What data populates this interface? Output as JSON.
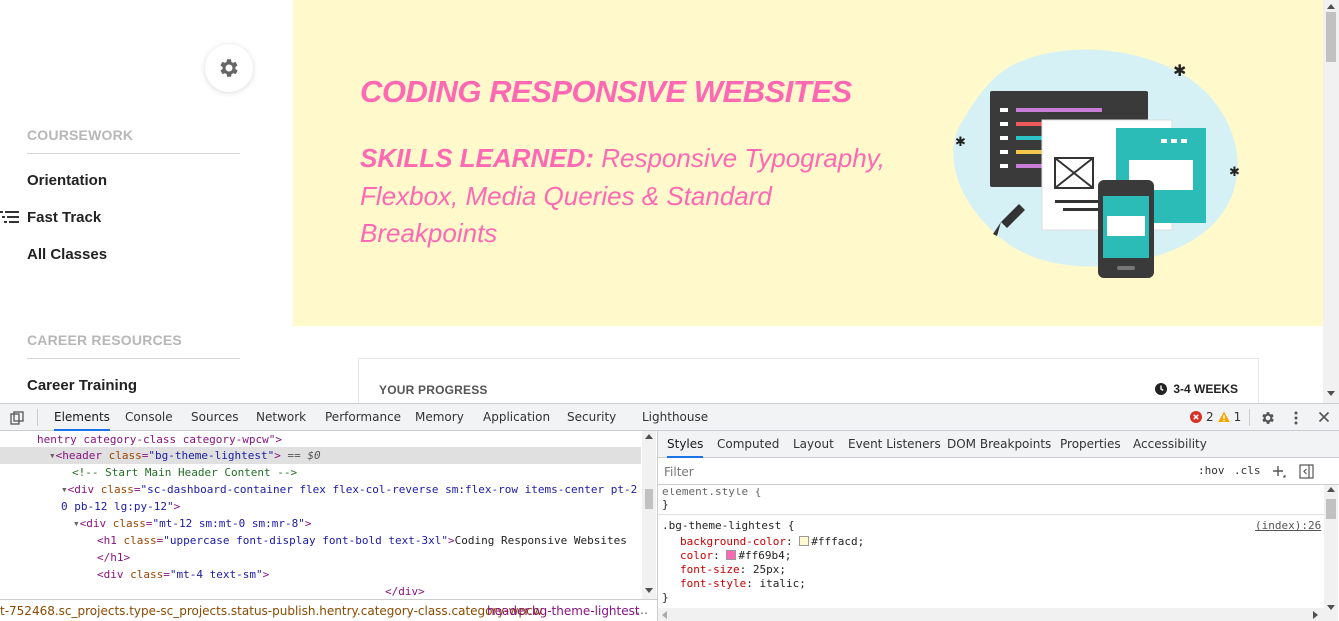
{
  "sidebar": {
    "coursework_title": "COURSEWORK",
    "coursework_items": [
      "Orientation",
      "Fast Track",
      "All Classes"
    ],
    "career_title": "CAREER RESOURCES",
    "career_items": [
      "Career Training"
    ]
  },
  "hero": {
    "title": "CODING RESPONSIVE WEBSITES",
    "skills_label": "SKILLS LEARNED:",
    "skills_text": " Responsive Typography, Flexbox, Media Queries & Standard Breakpoints",
    "background": "#fff9cc",
    "accent": "#ff69b4"
  },
  "progress": {
    "label": "YOUR PROGRESS",
    "duration": "3-4 WEEKS"
  },
  "devtools": {
    "tabs": [
      "Elements",
      "Console",
      "Sources",
      "Network",
      "Performance",
      "Memory",
      "Application",
      "Security",
      "Lighthouse"
    ],
    "active_tab": "Elements",
    "error_count": "2",
    "warning_count": "1",
    "dom": {
      "l0_text": "hentry category-class category-wpcw\">",
      "l1_tag": "header",
      "l1_attr": "class",
      "l1_val": "\"bg-theme-lightest\"",
      "l1_suffix": " == $0",
      "l2_comment": "<!-- Start Main Header Content -->",
      "l3_attr": "class",
      "l3_val_a": "\"sc-dashboard-container flex flex-col-reverse sm:flex-row items-center pt-2",
      "l3_val_b": "0 pb-12 lg:py-12\"",
      "l4_val": "\"mt-12 sm:mt-0 sm:mr-8\"",
      "l5_val": "\"uppercase font-display font-bold text-3xl\"",
      "l5_text": "Coding Responsive Websites",
      "l6_text": "</h1>",
      "l7_val": "\"mt-4 text-sm\"",
      "l8_text": "</div>"
    },
    "breadcrumb_a": "t-752468.sc_projects.type-sc_projects.status-publish.hentry.category-class.category-wpcw",
    "breadcrumb_b": "header.bg-theme-lightest",
    "breadcrumb_more": "…",
    "styles_tabs": [
      "Styles",
      "Computed",
      "Layout",
      "Event Listeners",
      "DOM Breakpoints",
      "Properties",
      "Accessibility"
    ],
    "filter_placeholder": "Filter",
    "hov_label": ":hov",
    "cls_label": ".cls",
    "css": {
      "element_style": "element.style {",
      "close": "}",
      "selector": ".bg-theme-lightest {",
      "source": "(index):26",
      "rules": [
        {
          "prop": "background-color",
          "value": "#fffacd;",
          "swatch": "#fffacd"
        },
        {
          "prop": "color",
          "value": "#ff69b4;",
          "swatch": "#ff69b4"
        },
        {
          "prop": "font-size",
          "value": "25px;"
        },
        {
          "prop": "font-style",
          "value": "italic;"
        }
      ]
    }
  }
}
